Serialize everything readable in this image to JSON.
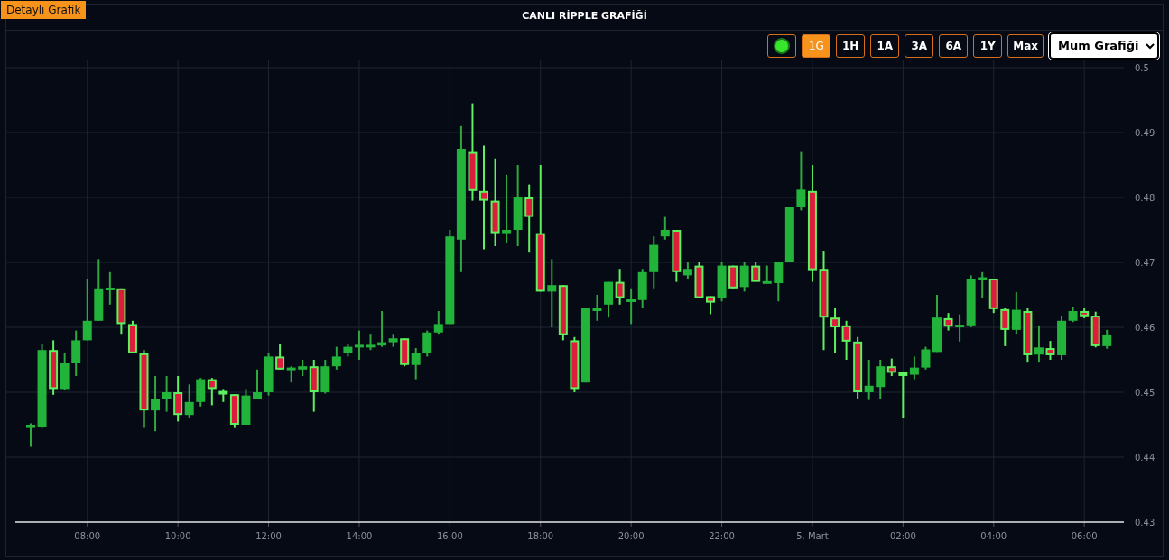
{
  "badge": "Detaylı Grafik",
  "title": "CANLI RİPPLE GRAFİĞİ",
  "toolbar": {
    "live": {
      "on": true
    },
    "ranges": [
      {
        "label": "1G",
        "selected": true
      },
      {
        "label": "1H",
        "selected": false
      },
      {
        "label": "1A",
        "selected": false
      },
      {
        "label": "3A",
        "selected": false
      },
      {
        "label": "6A",
        "selected": false
      },
      {
        "label": "1Y",
        "selected": false
      },
      {
        "label": "Max",
        "selected": false
      }
    ],
    "chart_type": {
      "value": "Mum Grafiği"
    }
  },
  "chart_data": {
    "type": "candlestick",
    "grid": true,
    "ylim": [
      0.43,
      0.5
    ],
    "yticks": [
      0.43,
      0.44,
      0.45,
      0.46,
      0.47,
      0.48,
      0.49,
      0.5
    ],
    "categories": [
      null,
      null,
      null,
      null,
      null,
      "08:00",
      null,
      null,
      null,
      null,
      null,
      null,
      null,
      "10:00",
      null,
      null,
      null,
      null,
      null,
      null,
      null,
      "12:00",
      null,
      null,
      null,
      null,
      null,
      null,
      null,
      "14:00",
      null,
      null,
      null,
      null,
      null,
      null,
      null,
      "16:00",
      null,
      null,
      null,
      null,
      null,
      null,
      null,
      "18:00",
      null,
      null,
      null,
      null,
      null,
      null,
      null,
      "20:00",
      null,
      null,
      null,
      null,
      null,
      null,
      null,
      "22:00",
      null,
      null,
      null,
      null,
      null,
      null,
      null,
      "5. Mart",
      null,
      null,
      null,
      null,
      null,
      null,
      null,
      "02:00",
      null,
      null,
      null,
      null,
      null,
      null,
      null,
      "04:00",
      null,
      null,
      null,
      null,
      null,
      null,
      null,
      "06:00",
      null,
      null
    ],
    "ohlc": [
      [
        0.4445,
        0.4452,
        0.4416,
        0.445
      ],
      [
        0.4447,
        0.4575,
        0.4445,
        0.4565
      ],
      [
        0.4565,
        0.458,
        0.4496,
        0.4505
      ],
      [
        0.4505,
        0.456,
        0.4503,
        0.4545
      ],
      [
        0.4545,
        0.4595,
        0.4525,
        0.458
      ],
      [
        0.458,
        0.4675,
        0.458,
        0.461
      ],
      [
        0.461,
        0.4705,
        0.461,
        0.466
      ],
      [
        0.4658,
        0.4685,
        0.4635,
        0.466
      ],
      [
        0.466,
        0.466,
        0.459,
        0.4605
      ],
      [
        0.4605,
        0.461,
        0.456,
        0.456
      ],
      [
        0.456,
        0.4565,
        0.4445,
        0.4472
      ],
      [
        0.4472,
        0.4525,
        0.444,
        0.449
      ],
      [
        0.449,
        0.4525,
        0.447,
        0.45
      ],
      [
        0.45,
        0.4525,
        0.4455,
        0.4465
      ],
      [
        0.4465,
        0.4512,
        0.446,
        0.4485
      ],
      [
        0.4485,
        0.4522,
        0.4478,
        0.452
      ],
      [
        0.452,
        0.4522,
        0.448,
        0.4505
      ],
      [
        0.4502,
        0.4505,
        0.4485,
        0.4497
      ],
      [
        0.4497,
        0.4497,
        0.4445,
        0.445
      ],
      [
        0.445,
        0.4505,
        0.445,
        0.4495
      ],
      [
        0.449,
        0.4535,
        0.449,
        0.45
      ],
      [
        0.45,
        0.456,
        0.4495,
        0.4555
      ],
      [
        0.4555,
        0.4575,
        0.4535,
        0.4535
      ],
      [
        0.4535,
        0.454,
        0.4515,
        0.4537
      ],
      [
        0.4535,
        0.455,
        0.4525,
        0.454
      ],
      [
        0.454,
        0.455,
        0.447,
        0.45
      ],
      [
        0.45,
        0.455,
        0.4498,
        0.454
      ],
      [
        0.454,
        0.457,
        0.4535,
        0.4555
      ],
      [
        0.456,
        0.4575,
        0.4555,
        0.457
      ],
      [
        0.457,
        0.4595,
        0.455,
        0.4572
      ],
      [
        0.457,
        0.459,
        0.4565,
        0.4572
      ],
      [
        0.4572,
        0.4625,
        0.457,
        0.4577
      ],
      [
        0.4577,
        0.459,
        0.457,
        0.4583
      ],
      [
        0.4583,
        0.4583,
        0.454,
        0.4542
      ],
      [
        0.4542,
        0.4568,
        0.452,
        0.456
      ],
      [
        0.456,
        0.4595,
        0.4555,
        0.4592
      ],
      [
        0.4592,
        0.4625,
        0.459,
        0.4605
      ],
      [
        0.4605,
        0.475,
        0.4605,
        0.474
      ],
      [
        0.4735,
        0.491,
        0.4685,
        0.4875
      ],
      [
        0.487,
        0.4945,
        0.4795,
        0.481
      ],
      [
        0.481,
        0.488,
        0.472,
        0.4795
      ],
      [
        0.4795,
        0.486,
        0.4725,
        0.4745
      ],
      [
        0.4745,
        0.4835,
        0.473,
        0.475
      ],
      [
        0.475,
        0.485,
        0.4725,
        0.48
      ],
      [
        0.48,
        0.482,
        0.4715,
        0.477
      ],
      [
        0.4745,
        0.485,
        0.4655,
        0.4655
      ],
      [
        0.4655,
        0.4705,
        0.46,
        0.4665
      ],
      [
        0.4665,
        0.4665,
        0.458,
        0.4588
      ],
      [
        0.458,
        0.4585,
        0.45,
        0.4505
      ],
      [
        0.4515,
        0.463,
        0.4515,
        0.463
      ],
      [
        0.4625,
        0.465,
        0.461,
        0.463
      ],
      [
        0.4635,
        0.467,
        0.4615,
        0.467
      ],
      [
        0.467,
        0.469,
        0.4635,
        0.4645
      ],
      [
        0.464,
        0.466,
        0.4605,
        0.4642
      ],
      [
        0.4642,
        0.469,
        0.463,
        0.4685
      ],
      [
        0.4685,
        0.474,
        0.466,
        0.4727
      ],
      [
        0.474,
        0.477,
        0.4735,
        0.475
      ],
      [
        0.475,
        0.475,
        0.467,
        0.4685
      ],
      [
        0.468,
        0.47,
        0.4675,
        0.469
      ],
      [
        0.4695,
        0.47,
        0.4645,
        0.4645
      ],
      [
        0.4648,
        0.4648,
        0.462,
        0.4638
      ],
      [
        0.4645,
        0.47,
        0.464,
        0.4695
      ],
      [
        0.4695,
        0.4695,
        0.466,
        0.466
      ],
      [
        0.4662,
        0.47,
        0.4655,
        0.4695
      ],
      [
        0.4695,
        0.47,
        0.467,
        0.467
      ],
      [
        0.4668,
        0.4695,
        0.4668,
        0.467
      ],
      [
        0.4668,
        0.47,
        0.464,
        0.47
      ],
      [
        0.47,
        0.4785,
        0.47,
        0.4785
      ],
      [
        0.4785,
        0.487,
        0.478,
        0.4812
      ],
      [
        0.481,
        0.485,
        0.467,
        0.4688
      ],
      [
        0.469,
        0.4718,
        0.4565,
        0.4615
      ],
      [
        0.4615,
        0.463,
        0.456,
        0.46
      ],
      [
        0.4603,
        0.461,
        0.455,
        0.4578
      ],
      [
        0.4578,
        0.4585,
        0.449,
        0.45
      ],
      [
        0.45,
        0.455,
        0.4488,
        0.451
      ],
      [
        0.4508,
        0.455,
        0.449,
        0.454
      ],
      [
        0.454,
        0.4552,
        0.4525,
        0.453
      ],
      [
        0.453,
        0.453,
        0.446,
        0.4527
      ],
      [
        0.4527,
        0.4555,
        0.452,
        0.4538
      ],
      [
        0.4538,
        0.457,
        0.4535,
        0.4566
      ],
      [
        0.4562,
        0.465,
        0.4562,
        0.4615
      ],
      [
        0.4614,
        0.4622,
        0.4595,
        0.4601
      ],
      [
        0.4601,
        0.462,
        0.4578,
        0.4603
      ],
      [
        0.4603,
        0.468,
        0.46,
        0.4675
      ],
      [
        0.4675,
        0.4685,
        0.4645,
        0.4675
      ],
      [
        0.4675,
        0.4675,
        0.4622,
        0.4628
      ],
      [
        0.4628,
        0.463,
        0.4571,
        0.4596
      ],
      [
        0.4596,
        0.4654,
        0.459,
        0.4627
      ],
      [
        0.4625,
        0.463,
        0.4547,
        0.4557
      ],
      [
        0.4558,
        0.4603,
        0.4547,
        0.4569
      ],
      [
        0.4568,
        0.4579,
        0.455,
        0.4557
      ],
      [
        0.4557,
        0.4618,
        0.455,
        0.461
      ],
      [
        0.461,
        0.4632,
        0.4608,
        0.4625
      ],
      [
        0.4625,
        0.4629,
        0.4614,
        0.4617
      ],
      [
        0.4618,
        0.4624,
        0.4569,
        0.4571
      ],
      [
        0.4571,
        0.4596,
        0.4567,
        0.4589
      ]
    ]
  }
}
